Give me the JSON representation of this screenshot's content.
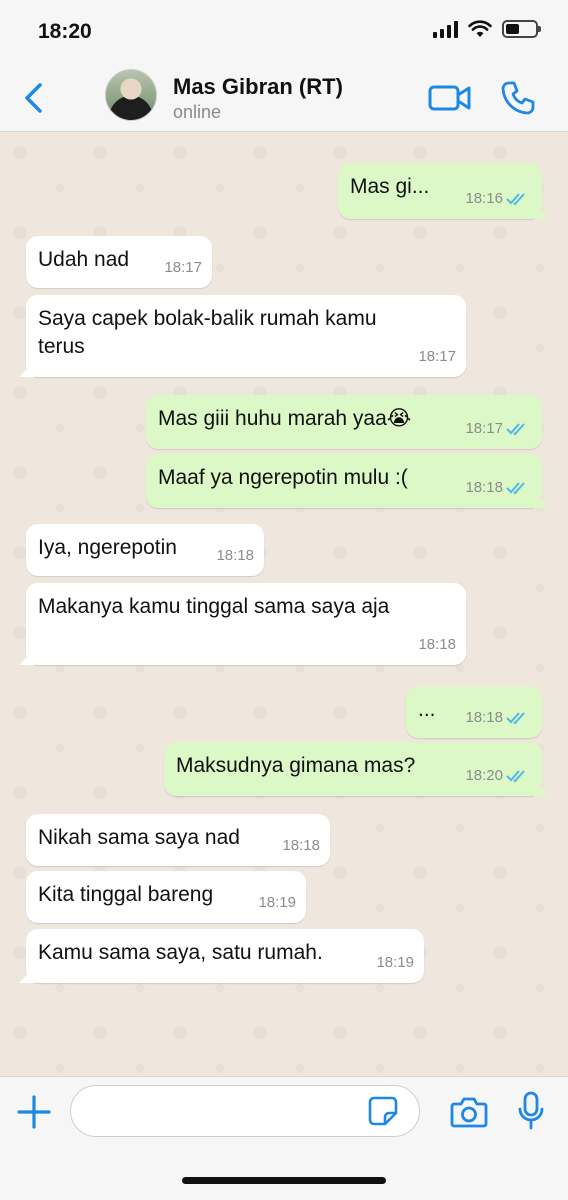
{
  "status_bar": {
    "time": "18:20"
  },
  "header": {
    "contact_name": "Mas Gibran (RT)",
    "contact_status": "online",
    "icons": [
      "chevron-left-icon",
      "video-camera-icon",
      "phone-icon"
    ]
  },
  "colors": {
    "accent": "#1e88e5",
    "outgoing_bubble": "#dcf8c6",
    "incoming_bubble": "#ffffff",
    "chat_background": "#efe7dd",
    "read_ticks": "#4fb6ec"
  },
  "messages": [
    {
      "direction": "out",
      "text": "Mas gi...",
      "time": "18:16",
      "read": true
    },
    {
      "direction": "in",
      "text": "Udah nad",
      "time": "18:17"
    },
    {
      "direction": "in",
      "text": "Saya capek bolak-balik rumah kamu terus",
      "time": "18:17"
    },
    {
      "direction": "out",
      "text": "Mas giii huhu marah yaa😭",
      "time": "18:17",
      "read": true
    },
    {
      "direction": "out",
      "text": "Maaf ya ngerepotin mulu :(",
      "time": "18:18",
      "read": true
    },
    {
      "direction": "in",
      "text": "Iya, ngerepotin",
      "time": "18:18"
    },
    {
      "direction": "in",
      "text": "Makanya kamu tinggal sama saya aja",
      "time": "18:18"
    },
    {
      "direction": "out",
      "text": "...",
      "time": "18:18",
      "read": true
    },
    {
      "direction": "out",
      "text": "Maksudnya gimana mas?",
      "time": "18:20",
      "read": true
    },
    {
      "direction": "in",
      "text": "Nikah sama saya nad",
      "time": "18:18"
    },
    {
      "direction": "in",
      "text": "Kita tinggal bareng",
      "time": "18:19"
    },
    {
      "direction": "in",
      "text": "Kamu sama saya, satu rumah.",
      "time": "18:19"
    }
  ],
  "composer": {
    "value": "",
    "icons": [
      "plus-icon",
      "sticker-icon",
      "camera-icon",
      "microphone-icon"
    ]
  }
}
